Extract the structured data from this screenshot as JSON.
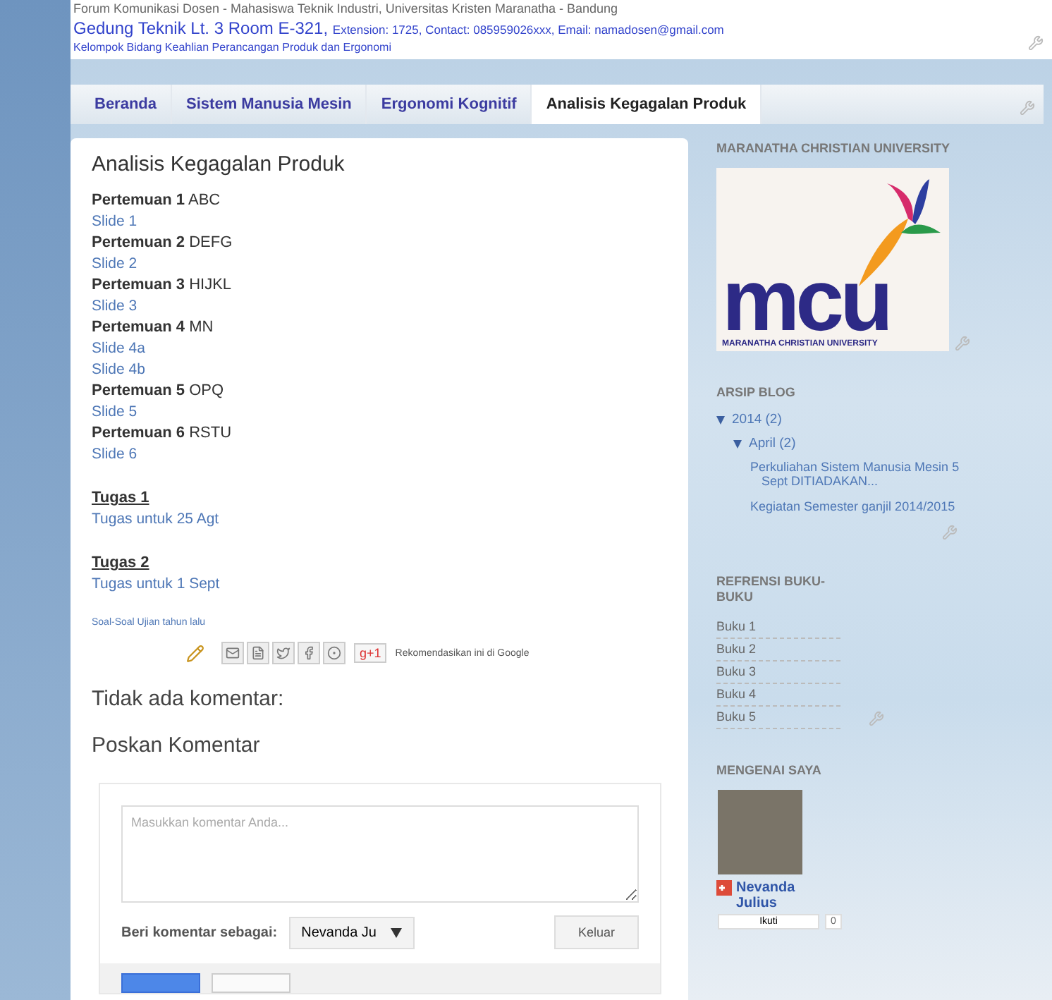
{
  "header": {
    "forum": "Forum Komunikasi Dosen - Mahasiswa Teknik Industri, Universitas Kristen Maranatha - Bandung",
    "location": "Gedung Teknik Lt. 3 Room E-321,",
    "contact": "Extension: 1725, Contact: 085959026xxx, Email: namadosen@gmail.com",
    "group": "Kelompok Bidang Keahlian Perancangan Produk dan Ergonomi"
  },
  "tabs": [
    {
      "label": "Beranda",
      "selected": false
    },
    {
      "label": "Sistem Manusia Mesin",
      "selected": false
    },
    {
      "label": "Ergonomi Kognitif",
      "selected": false
    },
    {
      "label": "Analisis Kegagalan Produk",
      "selected": true
    }
  ],
  "post": {
    "title": "Analisis Kegagalan Produk",
    "meetings": [
      {
        "label": "Pertemuan 1",
        "topic": "ABC",
        "links": [
          "Slide 1"
        ]
      },
      {
        "label": "Pertemuan 2",
        "topic": "DEFG",
        "links": [
          "Slide 2"
        ]
      },
      {
        "label": "Pertemuan 3",
        "topic": "HIJKL",
        "links": [
          "Slide 3"
        ]
      },
      {
        "label": "Pertemuan 4",
        "topic": "MN",
        "links": [
          "Slide 4a",
          "Slide 4b"
        ]
      },
      {
        "label": "Pertemuan 5",
        "topic": "OPQ",
        "links": [
          "Slide 5"
        ]
      },
      {
        "label": "Pertemuan 6",
        "topic": "RSTU",
        "links": [
          "Slide 6"
        ]
      }
    ],
    "assignments": [
      {
        "title": "Tugas 1",
        "link": "Tugas untuk 25 Agt"
      },
      {
        "title": "Tugas 2",
        "link": "Tugas untuk 1 Sept"
      }
    ],
    "exam_link": "Soal-Soal Ujian tahun lalu",
    "plus_one": "g+1",
    "recommend": "Rekomendasikan ini di Google"
  },
  "comments": {
    "none": "Tidak ada komentar:",
    "heading": "Poskan Komentar",
    "placeholder": "Masukkan komentar Anda...",
    "as_label": "Beri komentar sebagai:",
    "identity": "Nevanda Ju",
    "sign_out": "Keluar"
  },
  "sidebar": {
    "university": {
      "title": "MARANATHA CHRISTIAN UNIVERSITY",
      "logo_word": "mcu",
      "logo_caption": "MARANATHA CHRISTIAN UNIVERSITY"
    },
    "archive": {
      "title": "ARSIP BLOG",
      "tree": [
        {
          "label": "2014 (2)",
          "expanded": true,
          "children": [
            {
              "label": "April (2)",
              "expanded": true,
              "posts": [
                "Perkuliahan Sistem Manusia Mesin 5 Sept DITIADAKAN...",
                "Kegiatan Semester ganjil 2014/2015"
              ]
            }
          ]
        }
      ]
    },
    "books": {
      "title": "REFRENSI BUKU-BUKU",
      "items": [
        "Buku 1",
        "Buku 2",
        "Buku 3",
        "Buku 4",
        "Buku 5"
      ]
    },
    "about": {
      "title": "MENGENAI SAYA",
      "name": "Nevanda Julius",
      "follow": "Ikuti",
      "count": "0"
    }
  }
}
